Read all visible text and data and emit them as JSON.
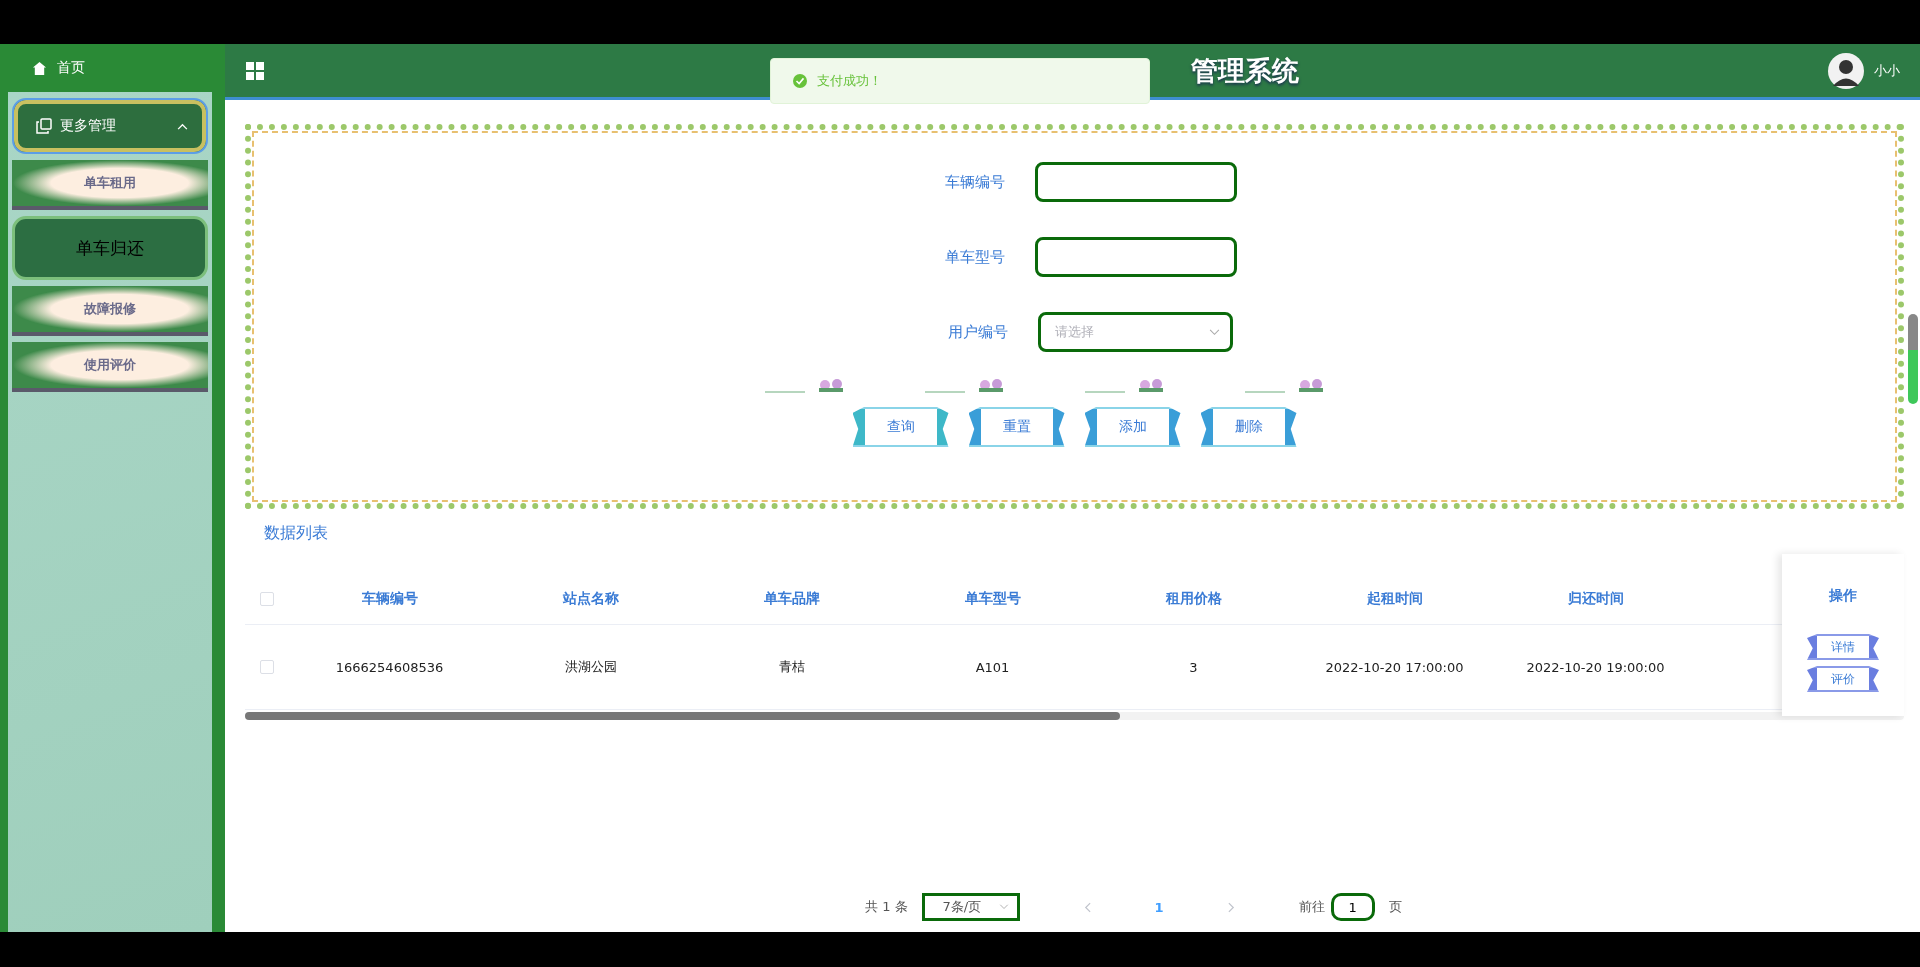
{
  "header": {
    "title": "管理系统",
    "user": "小小"
  },
  "toast": {
    "message": "支付成功！"
  },
  "sidebar": {
    "home": "首页",
    "groups": [
      {
        "label": "更多管理",
        "expanded": true,
        "children": [
          {
            "label": "单车租用",
            "selected": false
          },
          {
            "label": "单车归还",
            "selected": true
          },
          {
            "label": "故障报修",
            "selected": false
          },
          {
            "label": "使用评价",
            "selected": false
          }
        ]
      }
    ]
  },
  "form": {
    "fields": [
      {
        "kind": "input",
        "label": "车辆编号"
      },
      {
        "kind": "input",
        "label": "单车型号"
      },
      {
        "kind": "select",
        "label": "用户编号",
        "placeholder": "请选择"
      }
    ],
    "buttons": [
      "查询",
      "重置",
      "添加",
      "删除"
    ]
  },
  "table": {
    "title": "数据列表",
    "all_checked": false,
    "columns": [
      "车辆编号",
      "站点名称",
      "单车品牌",
      "单车型号",
      "租用价格",
      "起租时间",
      "归还时间"
    ],
    "action_column": "操作",
    "rows": [
      {
        "checked": false,
        "cells": [
          "1666254608536",
          "洪湖公园",
          "青桔",
          "A101",
          "3",
          "2022-10-20 17:00:00",
          "2022-10-20 19:00:00"
        ],
        "actions": [
          "详情",
          "评价"
        ]
      }
    ]
  },
  "pagination": {
    "total": "共 1 条",
    "page_size": "7条/页",
    "pages": [
      {
        "label": "1",
        "selected": true
      }
    ],
    "goto_label": "前往",
    "goto_value": "1",
    "goto_suffix": "页"
  }
}
